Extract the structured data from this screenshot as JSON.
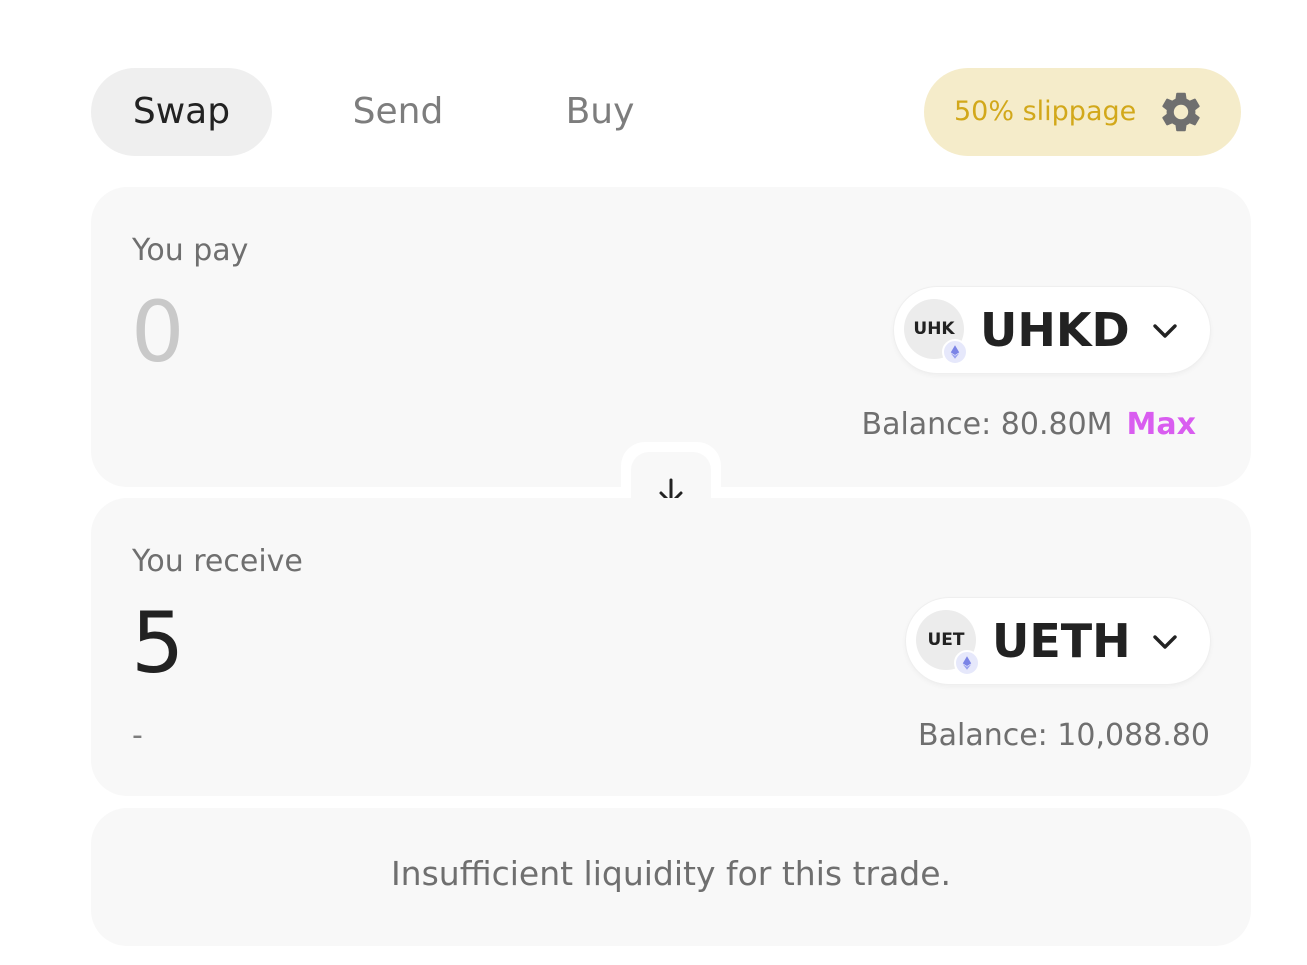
{
  "tabs": [
    {
      "label": "Swap",
      "active": true
    },
    {
      "label": "Send",
      "active": false
    },
    {
      "label": "Buy",
      "active": false
    }
  ],
  "slippage": {
    "label": "50% slippage",
    "icon": "gear-icon"
  },
  "pay": {
    "label": "You pay",
    "amount": "0",
    "token": {
      "logo_text": "UHK",
      "symbol": "UHKD",
      "chain_icon": "ethereum-icon"
    },
    "balance": "Balance: 80.80M",
    "max_label": "Max"
  },
  "switch": {
    "icon": "arrow-down-icon"
  },
  "receive": {
    "label": "You receive",
    "amount": "5",
    "usd_value": "-",
    "token": {
      "logo_text": "UET",
      "symbol": "UETH",
      "chain_icon": "ethereum-icon"
    },
    "balance": "Balance: 10,088.80"
  },
  "message": "Insufficient liquidity for this trade.",
  "colors": {
    "accent": "#d95df0",
    "slippage_bg": "#f5ecca",
    "slippage_text": "#d2a81a"
  }
}
